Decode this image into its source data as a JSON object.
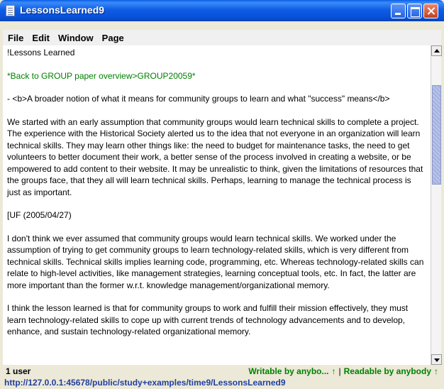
{
  "window": {
    "title": "LessonsLearned9"
  },
  "menu": [
    "File",
    "Edit",
    "Window",
    "Page"
  ],
  "document": {
    "heading": "!Lessons Learned",
    "back_link": "*Back to GROUP paper overview>GROUP20059*",
    "bullet": "- <b>A broader notion of what it means for community groups to learn and what \"success\" means</b>",
    "para1": "We started with an early assumption that community groups would learn technical skills to complete a project. The experience with the Historical Society alerted us to the idea that not everyone in an organization will learn technical skills. They may learn other things like: the need to budget for maintenance tasks, the need to get volunteers to better document their work, a better sense of the process involved in creating a website, or be empowered to add content to their website. It may be unrealistic to think, given the limitations of resources that the groups face, that they all will learn technical skills. Perhaps, learning to manage the technical process is just as important.",
    "tag": "[UF (2005/04/27)",
    "para2": "I don't think we ever assumed that community groups would learn technical skills. We worked under the assumption of trying to get community groups to learn technology-related skills, which is very different from technical skills. Technical skills implies learning code, programming, etc. Whereas technology-related skills can relate to high-level activities, like management strategies, learning conceptual tools, etc. In fact, the latter are more important than the former w.r.t. knowledge management/organizational memory.",
    "para3": "I think the lesson learned is that for community groups to work and fulfill their mission effectively, they must learn technology-related skills to cope up with current trends of technology advancements and to develop, enhance, and sustain technology-related organizational memory."
  },
  "status": {
    "users": "1 user",
    "writable": "Writable by anybo...",
    "separator": "|",
    "readable": "Readable by anybody",
    "arrow": "↑"
  },
  "url": "http://127.0.0.1:45678/public/study+examples/time9/LessonsLearned9",
  "colors": {
    "titlebar": "#0a5ee8",
    "green_text": "#008000",
    "url_text": "#1f3fa0"
  }
}
